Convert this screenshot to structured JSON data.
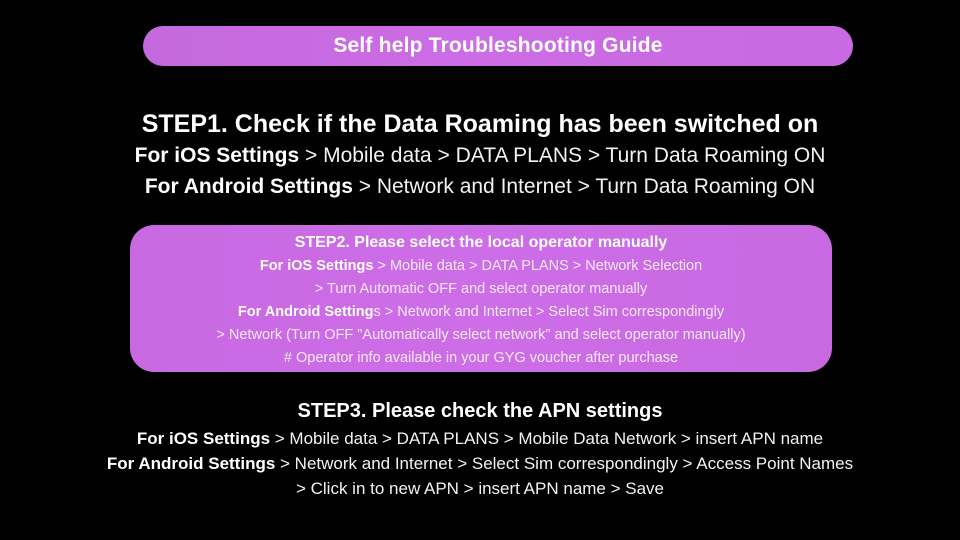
{
  "colors": {
    "background": "#000000",
    "accent_purple": "#ca6ae4",
    "text_primary": "#ffffff",
    "text_on_panel": "#f6e9fb"
  },
  "banner": {
    "title": "Self help Troubleshooting Guide"
  },
  "step1": {
    "heading": "STEP1. Check if the Data Roaming has been switched on",
    "lines": [
      {
        "bold_prefix": "For iOS Settings",
        "rest": " > Mobile data > DATA PLANS > Turn Data Roaming ON"
      },
      {
        "bold_prefix": "For Android Settings",
        "rest": " > Network and Internet > Turn Data Roaming ON"
      }
    ]
  },
  "step2": {
    "heading": "STEP2. Please select the local operator manually",
    "lines": [
      {
        "bold_prefix": "For iOS Settings",
        "rest": " > Mobile data > DATA PLANS > Network Selection"
      },
      {
        "bold_prefix": "",
        "rest": "> Turn Automatic OFF and select operator manually"
      },
      {
        "bold_prefix": "For Android Setting",
        "rest": "s > Network and Internet > Select Sim correspondingly"
      },
      {
        "bold_prefix": "",
        "rest": "> Network (Turn OFF \"Automatically select network\" and select operator manually)"
      },
      {
        "bold_prefix": "",
        "rest": "# Operator info available in your GYG voucher after purchase"
      }
    ]
  },
  "step3": {
    "heading": "STEP3. Please check the APN settings",
    "lines": [
      {
        "bold_prefix": "For iOS Settings",
        "rest": " > Mobile data > DATA PLANS > Mobile Data Network > insert APN name"
      },
      {
        "bold_prefix": "For Android Settings",
        "rest": " > Network and Internet > Select Sim correspondingly > Access Point Names"
      },
      {
        "bold_prefix": "",
        "rest": "> Click in to new APN > insert APN name > Save"
      }
    ]
  }
}
